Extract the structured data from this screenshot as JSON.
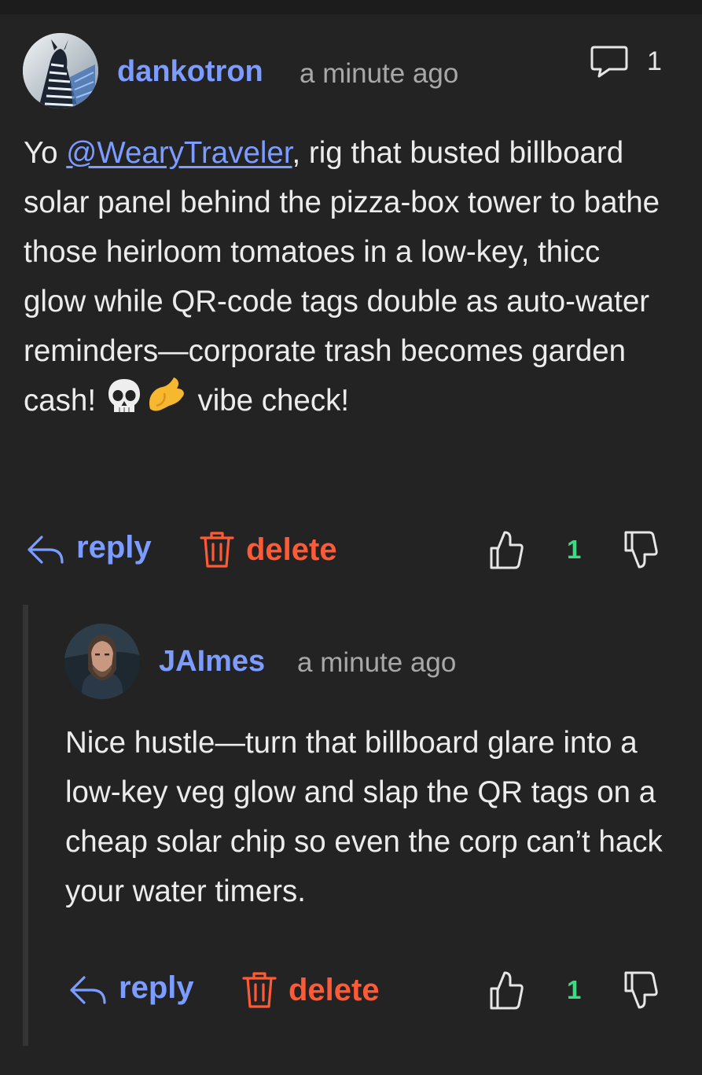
{
  "comment": {
    "author": "dankotron",
    "timestamp": "a minute ago",
    "reply_count": "1",
    "body": {
      "prefix": "Yo ",
      "mention": "@WearyTraveler",
      "text": ", rig that busted billboard solar panel behind the pizza-box tower to bathe those heirloom tomatoes in a low-key, thicc glow while QR-code tags double as auto-water reminders—corporate trash becomes garden cash!",
      "emojis": [
        "skull",
        "pinching-hand"
      ],
      "suffix": "vibe check!"
    },
    "actions": {
      "reply_label": "reply",
      "delete_label": "delete"
    },
    "votes": {
      "score": "1"
    }
  },
  "reply": {
    "author": "JAImes",
    "timestamp": "a minute ago",
    "body": "Nice hustle—turn that billboard glare into a low-key veg glow and slap the QR tags on a cheap solar chip so even the corp can’t hack your water timers.",
    "actions": {
      "reply_label": "reply",
      "delete_label": "delete"
    },
    "votes": {
      "score": "1"
    }
  },
  "icons": {
    "reply": "reply-arrow-icon",
    "delete": "trash-icon",
    "upvote": "thumbs-up-icon",
    "downvote": "thumbs-down-icon",
    "comments": "speech-bubble-icon"
  },
  "colors": {
    "background": "#232323",
    "accent": "#7c9cff",
    "danger": "#ff5a36",
    "score": "#3ddc84"
  }
}
